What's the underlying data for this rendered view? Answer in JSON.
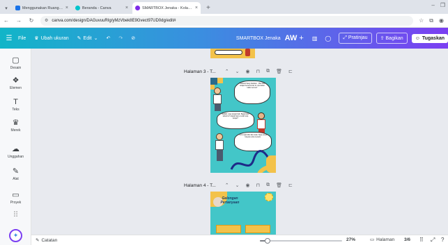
{
  "browser": {
    "tabs": [
      {
        "title": "Menggunakan Ruang GTK Me",
        "favicon_color": "#1a73e8",
        "active": false
      },
      {
        "title": "Beranda - Canva",
        "favicon_color": "#00c4cc",
        "active": false
      },
      {
        "title": "SMARTBOX Jenaka - Kolase Fo",
        "favicon_color": "#7d2ae8",
        "active": true
      }
    ],
    "new_tab_symbol": "+",
    "close_symbol": "×",
    "url": "canva.com/design/DAGuvuuRIg/yMzVbek8E9Gvect97UD0dg/edit#"
  },
  "canva_header": {
    "menu_file": "File",
    "menu_resize": "Ubah ukuran",
    "menu_edit": "Edit",
    "project_title": "SMARTBOX Jenaka",
    "aw_label": "AW",
    "aw_plus": "+",
    "preview_label": "Pratinjau",
    "share_label": "Bagikan",
    "task_label": "Tugaskan"
  },
  "sidebar": {
    "items": [
      {
        "label": "Desain",
        "icon": "layout-icon",
        "glyph": "▢"
      },
      {
        "label": "Elemen",
        "icon": "elements-icon",
        "glyph": "❖"
      },
      {
        "label": "Teks",
        "icon": "text-icon",
        "glyph": "T"
      },
      {
        "label": "Merek",
        "icon": "brand-icon",
        "glyph": "♛"
      },
      {
        "label": "Unggahan",
        "icon": "upload-icon",
        "glyph": "☁"
      },
      {
        "label": "Alat",
        "icon": "draw-icon",
        "glyph": "✎"
      },
      {
        "label": "Proyek",
        "icon": "folder-icon",
        "glyph": "▭"
      }
    ]
  },
  "pages": [
    {
      "label": "Halaman 3 - T..."
    },
    {
      "label": "Halaman 4 - T..."
    }
  ],
  "page3": {
    "bubble1": "Selamat Siang Sahabat... Mari kita belajar bersama hari ini. Apa kabar kalian semua?",
    "bubble2": "Baiklah, saya sangat baik. Bagaimana kabarmu? Apakah kamu sudah siap belajar?",
    "bubble3": "Tentu saja! Mari kita mulai. Saya punya banyak cerita menarik."
  },
  "page4": {
    "title_line1": "Gelongan",
    "title_line2": "Pertanyaan"
  },
  "bottombar": {
    "notes_label": "Catatan",
    "zoom_percent": 27,
    "zoom_label": "27%",
    "pages_label": "Halaman",
    "pages_count": "3/6"
  },
  "colors": {
    "header_start": "#12b5c8",
    "header_end": "#7b3ff2",
    "page_bg": "#43c6c8"
  }
}
